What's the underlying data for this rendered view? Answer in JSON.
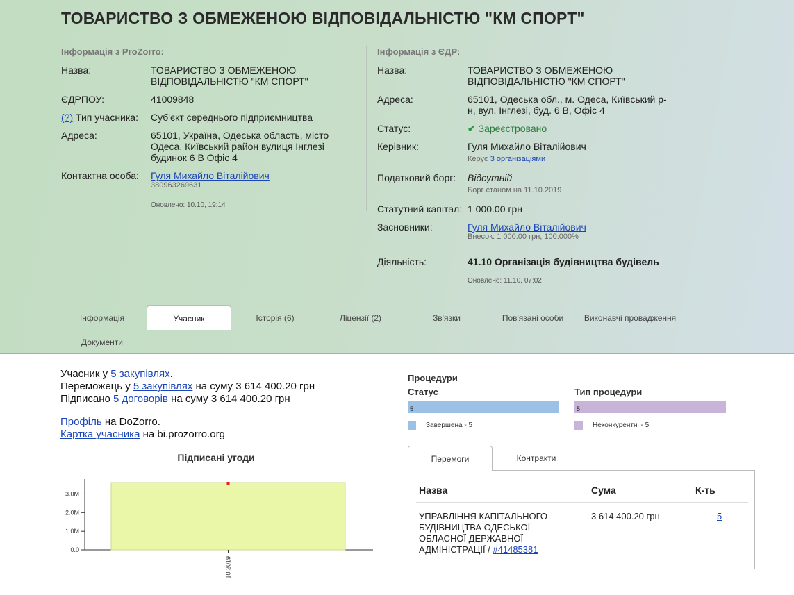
{
  "title": "ТОВАРИСТВО З ОБМЕЖЕНОЮ ВІДПОВІДАЛЬНІСТЮ \"КМ СПОРТ\"",
  "prozorro": {
    "heading": "Інформація з ProZorro:",
    "name_label": "Назва:",
    "name_line1": "ТОВАРИСТВО З ОБМЕЖЕНОЮ",
    "name_line2": "ВІДПОВІДАЛЬНІСТЮ \"КМ СПОРТ\"",
    "edrpou_label": "ЄДРПОУ:",
    "edrpou": "41009848",
    "help_link": "(?)",
    "type_label": "Тип учасника:",
    "type_value": "Суб'єкт середнього підприємництва",
    "address_label": "Адреса:",
    "address_line1": "65101, Україна, Одеська область, місто",
    "address_line2": "Одеса, Київський район вулиця Інглезі",
    "address_line3": "будинок 6 В Офіс 4",
    "contact_label": "Контактна особа:",
    "contact_name": "Гуля Михайло Віталійович",
    "contact_phone": "380963269631",
    "updated": "Оновлено: 10.10, 19:14"
  },
  "edr": {
    "heading": "Інформація з ЄДР:",
    "name_label": "Назва:",
    "name_line1": "ТОВАРИСТВО З ОБМЕЖЕНОЮ",
    "name_line2": "ВІДПОВІДАЛЬНІСТЮ \"КМ СПОРТ\"",
    "address_label": "Адреса:",
    "address_line1": "65101, Одеська обл., м. Одеса, Київський р-",
    "address_line2": "н, вул. Інглезі, буд. 6 В, Офіс 4",
    "status_label": "Статус:",
    "status_value": "Зареєстровано",
    "head_label": "Керівник:",
    "head_name": "Гуля Михайло Віталійович",
    "head_manages_prefix": "Керує",
    "head_manages_link": "3 організаціями",
    "tax_label": "Податковий борг:",
    "tax_value": "Відсутній",
    "tax_date": "Борг станом на 11.10.2019",
    "capital_label": "Статутний капітал:",
    "capital_value": "1 000.00 грн",
    "founders_label": "Засновники:",
    "founder_name": "Гуля Михайло Віталійович",
    "founder_share": "Внесок: 1 000.00 грн, 100.000%",
    "activity_label": "Діяльність:",
    "activity_value": "41.10 Організація будівництва будівель",
    "updated": "Оновлено: 11.10, 07:02"
  },
  "tabs": [
    "Інформація",
    "Учасник",
    "Історія (6)",
    "Ліцензії (2)",
    "Зв'язки",
    "Пов'язані особи",
    "Виконавчі провадження",
    "Документи"
  ],
  "participant": {
    "l1_prefix": "Учасник у",
    "l1_link": "5 закупівлях",
    "l1_suffix": ".",
    "l2_prefix": "Переможець у",
    "l2_link": "5 закупівлях",
    "l2_suffix": "на суму 3 614 400.20 грн",
    "l3_prefix": "Підписано",
    "l3_link": "5 договорів",
    "l3_suffix": "на суму 3 614 400.20 грн",
    "profile_link": "Профіль",
    "profile_suffix": "на DoZorro.",
    "card_link": "Картка учасника",
    "card_suffix": "на bi.prozorro.org"
  },
  "procedures": {
    "heading": "Процедури",
    "status_label": "Статус",
    "status_bar": "5",
    "status_legend": "Завершена - 5",
    "type_label": "Тип процедури",
    "type_bar": "5",
    "type_legend": "Неконкурентні - 5",
    "colors": {
      "status": "#9bc2e6",
      "type": "#c8b4d9"
    }
  },
  "wins": {
    "tabs": [
      "Перемоги",
      "Контракти"
    ],
    "col_name": "Назва",
    "col_sum": "Сума",
    "col_count": "К-ть",
    "row_name_l1": "УПРАВЛІННЯ КАПІТАЛЬНОГО",
    "row_name_l2": "БУДІВНИЦТВА ОДЕСЬКОЇ",
    "row_name_l3": "ОБЛАСНОЇ ДЕРЖАВНОЇ",
    "row_name_l4": "АДМІНІСТРАЦІЇ /",
    "row_link": "#41485381",
    "row_sum": "3 614 400.20 грн",
    "row_count": "5"
  },
  "chart_data": {
    "type": "bar",
    "title": "Підписані угоди",
    "categories": [
      "10.2019"
    ],
    "values": [
      3614400.2
    ],
    "yticks": [
      "0.0",
      "1.0M",
      "2.0M",
      "3.0M"
    ],
    "ylim": [
      0,
      3800000
    ],
    "color": "#eaf7a8",
    "edge_color": "#c9d98a"
  }
}
